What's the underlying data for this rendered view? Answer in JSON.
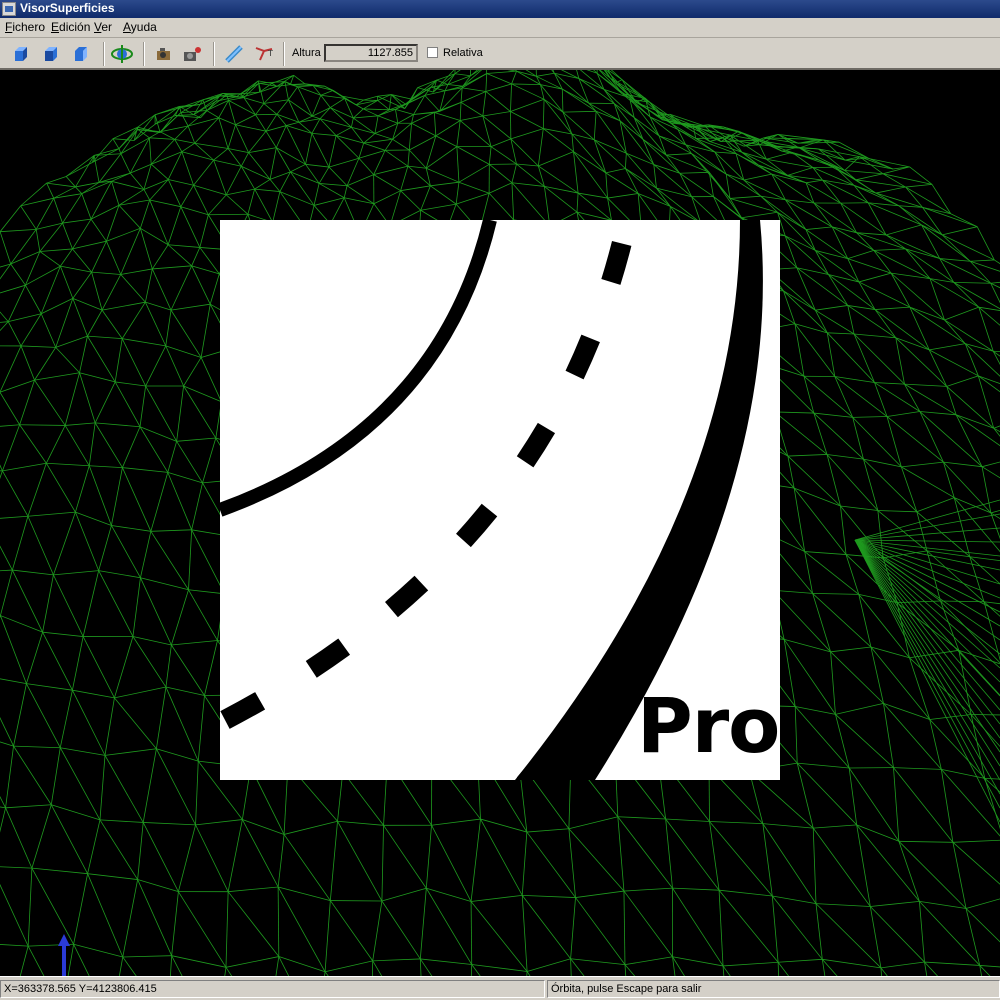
{
  "window": {
    "title": "VisorSuperficies",
    "icon": "app-icon"
  },
  "menu": [
    "Fichero",
    "Edición",
    "Ver",
    "Ayuda"
  ],
  "toolbar": {
    "buttons": [
      "view-front-cube-icon",
      "view-side-cube-icon",
      "view-top-cube-icon",
      "orbit-icon",
      "camera-icon",
      "camera-settings-icon",
      "measure-icon",
      "profile-icon"
    ],
    "altura_label": "Altura",
    "altura_value": "1127.855",
    "relativa_label": "Relativa",
    "relativa_checked": false
  },
  "overlay": {
    "logo_text": "Pro",
    "logo_icon": "road-icon"
  },
  "status": {
    "coordinates": "X=363378.565 Y=4123806.415",
    "message": "Órbita, pulse Escape para salir"
  },
  "colors": {
    "mesh": "#1f9a1f",
    "background": "#000000",
    "chrome": "#d4d0c8"
  }
}
